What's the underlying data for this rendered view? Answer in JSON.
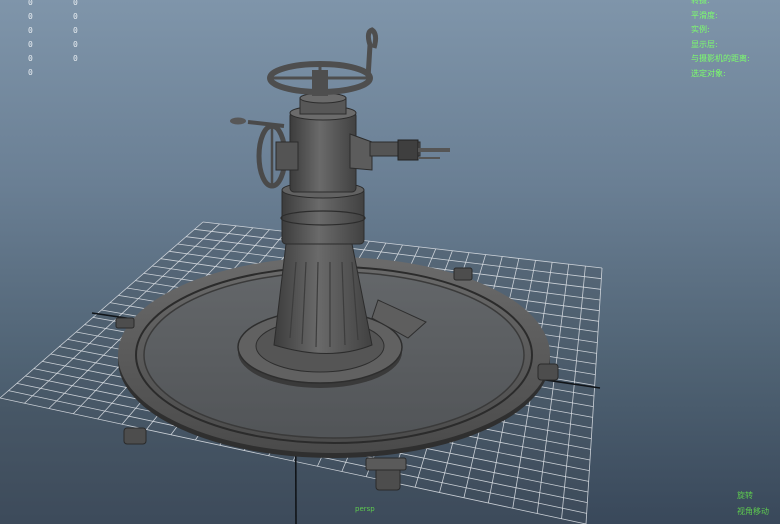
{
  "viewport": {
    "stats_left": [
      "0",
      "0",
      "0",
      "0",
      "0",
      "0"
    ],
    "stats_right": [
      "0",
      "0",
      "0",
      "0",
      "0"
    ],
    "hud_labels": [
      "转摄:",
      "平滑度:",
      "实例:",
      "显示层:",
      "与摄影机的距离:",
      "选定对象:"
    ],
    "bottom_right": [
      "旋转",
      "视角移动"
    ],
    "bottom_center": "persp"
  },
  "colors": {
    "background_top": "#7f95aa",
    "background_bottom": "#39485a",
    "hud_text": "#7cff6b",
    "model": "#5a5a5a",
    "grid": "#d8dde2"
  }
}
